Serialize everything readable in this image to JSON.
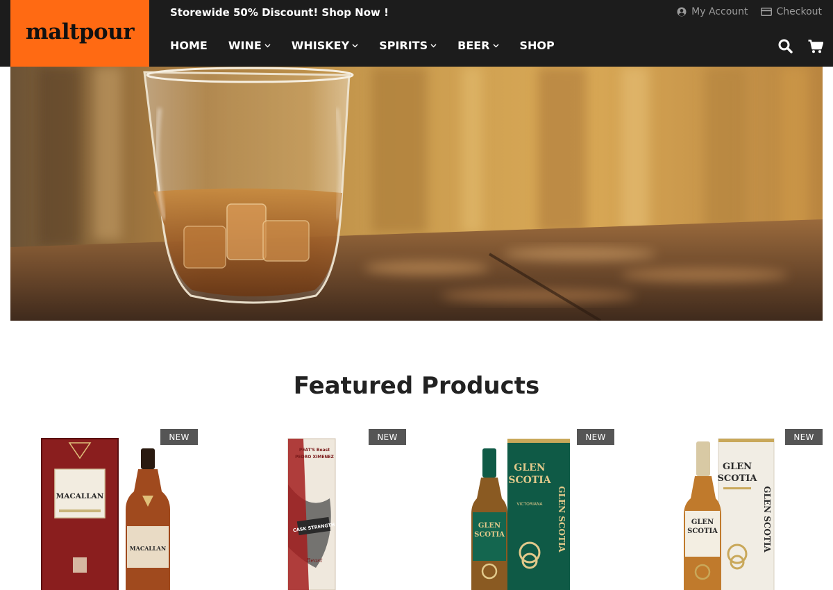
{
  "brand": {
    "logo_text": "maltpour",
    "accent": "#ff6a13"
  },
  "header": {
    "promo": "Storewide 50% Discount! Shop Now !",
    "account_links": [
      {
        "label": "My Account",
        "icon": "user-circle-icon"
      },
      {
        "label": "Checkout",
        "icon": "credit-card-icon"
      }
    ],
    "nav": [
      {
        "label": "HOME",
        "dropdown": false
      },
      {
        "label": "WINE",
        "dropdown": true
      },
      {
        "label": "WHISKEY",
        "dropdown": true
      },
      {
        "label": "SPIRITS",
        "dropdown": true
      },
      {
        "label": "BEER",
        "dropdown": true
      },
      {
        "label": "SHOP",
        "dropdown": false
      }
    ],
    "icons": [
      "search-icon",
      "cart-icon"
    ]
  },
  "hero": {
    "image": "whisky-glass-on-wooden-table"
  },
  "featured": {
    "title": "Featured Products",
    "products": [
      {
        "badge": "NEW",
        "image": "macallan-bottle-with-box"
      },
      {
        "badge": "NEW",
        "image": "peats-beast-tube"
      },
      {
        "badge": "NEW",
        "image": "glen-scotia-victoriana"
      },
      {
        "badge": "NEW",
        "image": "glen-scotia-double-cask"
      }
    ],
    "box_labels": {
      "macallan": "MACALLAN",
      "peats_beast": "PEAT'S Beast",
      "pedro_ximenez": "PEDRO XIMENEZ",
      "cask_strength": "CASK STRENGTH",
      "glen_scotia": "GLEN SCOTIA",
      "victoriana": "VICTORIANA"
    }
  }
}
